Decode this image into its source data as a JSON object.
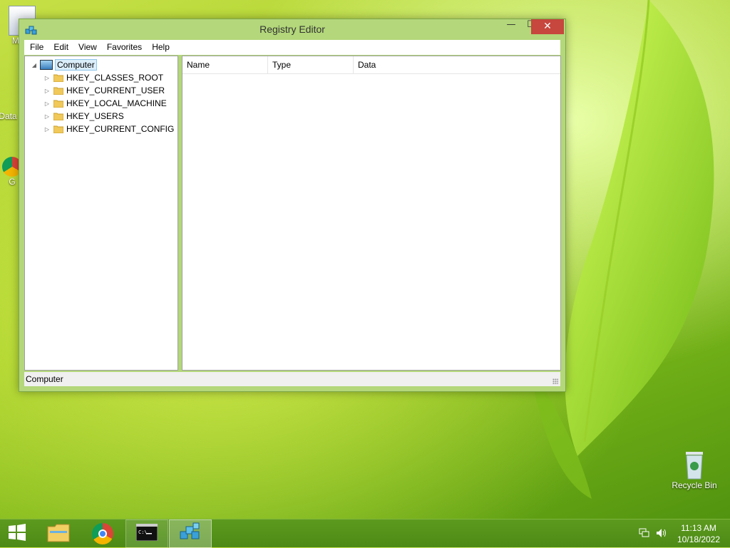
{
  "desktop": {
    "icons": [
      {
        "label": "My C"
      },
      {
        "label": "Data"
      },
      {
        "label": "G"
      },
      {
        "label": "Recycle Bin"
      }
    ]
  },
  "window": {
    "title": "Registry Editor",
    "minimize_glyph": "—",
    "maximize_glyph": "☐",
    "close_glyph": "✕",
    "menu": [
      "File",
      "Edit",
      "View",
      "Favorites",
      "Help"
    ],
    "tree": {
      "root": "Computer",
      "children": [
        "HKEY_CLASSES_ROOT",
        "HKEY_CURRENT_USER",
        "HKEY_LOCAL_MACHINE",
        "HKEY_USERS",
        "HKEY_CURRENT_CONFIG"
      ]
    },
    "columns": [
      "Name",
      "Type",
      "Data"
    ],
    "status": "Computer"
  },
  "taskbar": {
    "items": [
      "start-icon",
      "file-explorer-icon",
      "chrome-icon",
      "command-prompt-icon",
      "registry-editor-icon"
    ],
    "clock_time": "11:13 AM",
    "clock_date": "10/18/2022"
  },
  "colors": {
    "accent": "#b3d77a",
    "close": "#c7463d",
    "taskbar": "#4c8a16"
  }
}
